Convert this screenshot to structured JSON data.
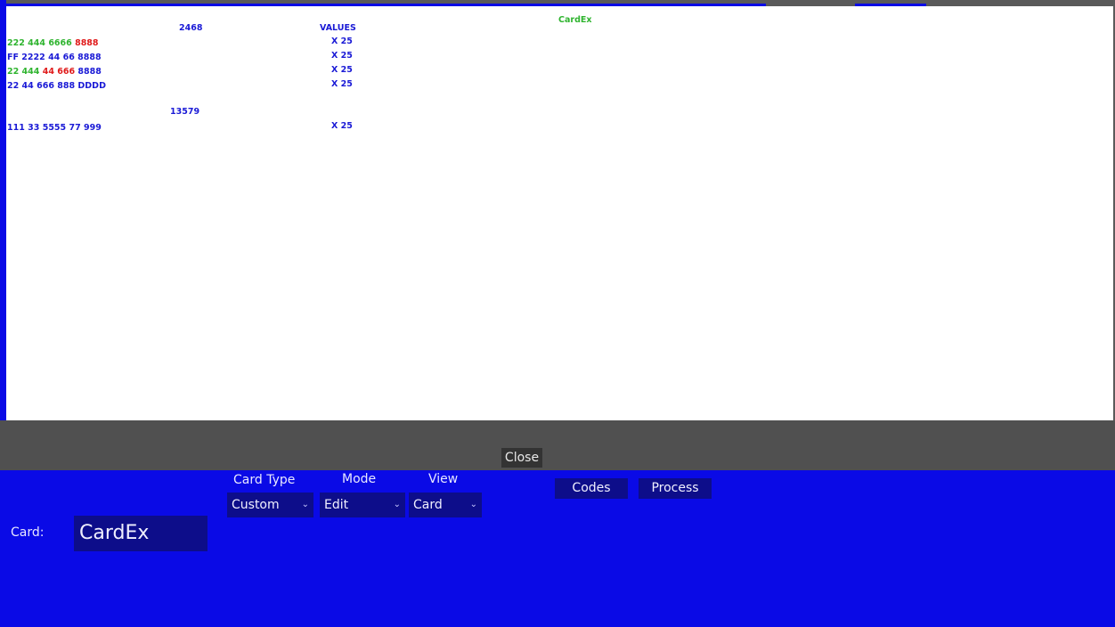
{
  "canvas": {
    "title": "CardEx",
    "header_col1": "2468",
    "header_col2": "VALUES",
    "rows": [
      {
        "parts": [
          {
            "text": "222",
            "color": "green"
          },
          {
            "text": "444",
            "color": "green"
          },
          {
            "text": "6666",
            "color": "green"
          },
          {
            "text": "8888",
            "color": "red"
          }
        ],
        "value": "X 25"
      },
      {
        "parts": [
          {
            "text": "FF",
            "color": "blue"
          },
          {
            "text": "2222",
            "color": "blue"
          },
          {
            "text": "44",
            "color": "blue"
          },
          {
            "text": "66",
            "color": "blue"
          },
          {
            "text": "8888",
            "color": "blue"
          }
        ],
        "value": "X 25"
      },
      {
        "parts": [
          {
            "text": "22",
            "color": "green"
          },
          {
            "text": "444",
            "color": "green"
          },
          {
            "text": "44",
            "color": "red"
          },
          {
            "text": "666",
            "color": "red"
          },
          {
            "text": "8888",
            "color": "blue"
          }
        ],
        "value": "X 25"
      },
      {
        "parts": [
          {
            "text": "22",
            "color": "blue"
          },
          {
            "text": "44",
            "color": "blue"
          },
          {
            "text": "666",
            "color": "blue"
          },
          {
            "text": "888",
            "color": "blue"
          },
          {
            "text": "DDDD",
            "color": "blue"
          }
        ],
        "value": "X 25"
      }
    ],
    "section2_header": "13579",
    "section2_rows": [
      {
        "parts": [
          {
            "text": "111",
            "color": "blue"
          },
          {
            "text": "33",
            "color": "blue"
          },
          {
            "text": "5555",
            "color": "blue"
          },
          {
            "text": "77",
            "color": "blue"
          },
          {
            "text": "999",
            "color": "blue"
          }
        ],
        "value": "X 25"
      }
    ]
  },
  "close_label": "Close",
  "controls": {
    "card_type_label": "Card Type",
    "card_type_value": "Custom",
    "mode_label": "Mode",
    "mode_value": "Edit",
    "view_label": "View",
    "view_value": "Card",
    "codes_label": "Codes",
    "process_label": "Process",
    "card_label": "Card:",
    "card_value": "CardEx"
  },
  "colors": {
    "panel_blue": "#0a0ae6",
    "text_blue": "#1a1ad6",
    "text_green": "#2fb42f",
    "text_red": "#e01a1a",
    "control_bg": "#0d0d8a"
  }
}
